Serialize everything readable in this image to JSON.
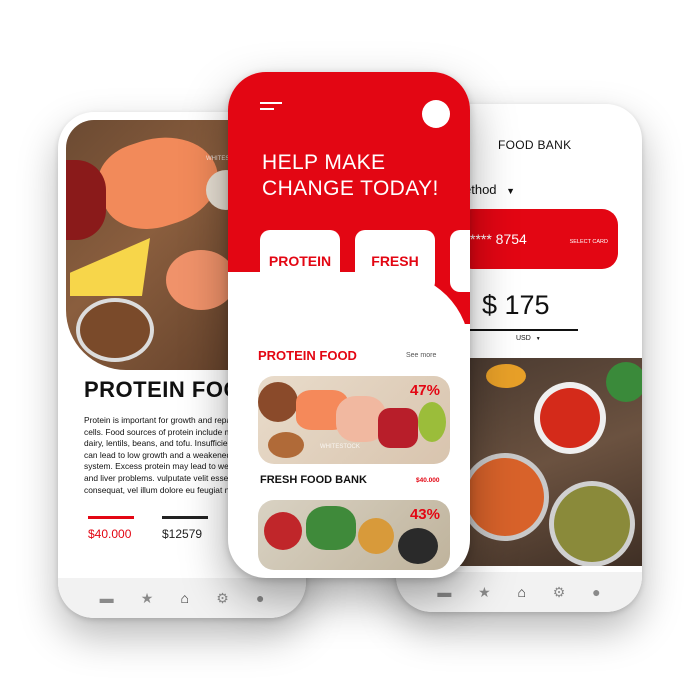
{
  "left_phone": {
    "hero_watermark": "WHITES",
    "title": "PROTEIN FOOD",
    "description": "Protein is important for growth and repai\ncells. Food sources of protein include mea\ndairy, lentils, beans, and tofu. Insufficient\ncan lead to low growth and a weakened in\nsystem. Excess protein may lead to weigh\nand liver problems. vulputate velit esse mo\nconsequat, vel illum dolore eu feugiat nu",
    "stats": [
      {
        "label": "$40.000"
      },
      {
        "label": "$12579"
      }
    ],
    "nav_icons": [
      "home-icon",
      "star-icon",
      "house-icon",
      "gear-icon",
      "user-icon"
    ]
  },
  "center_phone": {
    "headline": "HELP MAKE\nCHANGE TODAY!",
    "categories": [
      {
        "label": "PROTEIN"
      },
      {
        "label": "FRESH"
      }
    ],
    "section_title": "PROTEIN FOOD",
    "see_more": "See more",
    "card1_discount": "47%",
    "card1_watermark": "WHITESTOCK",
    "fresh_title": "FRESH FOOD BANK",
    "fresh_price": "$40.000",
    "card2_discount": "43%"
  },
  "right_phone": {
    "header_title": "FOOD BANK",
    "method_label": "ethod",
    "card_number": "**** 8754",
    "select_card": "SELECT CARD",
    "amount": "$ 175",
    "currency": "USD",
    "nav_icons": [
      "home-icon",
      "star-icon",
      "house-icon",
      "gear-icon",
      "user-icon"
    ]
  },
  "colors": {
    "accent_red": "#e30613",
    "text_dark": "#111111",
    "nav_bg": "#f2f2f2"
  }
}
